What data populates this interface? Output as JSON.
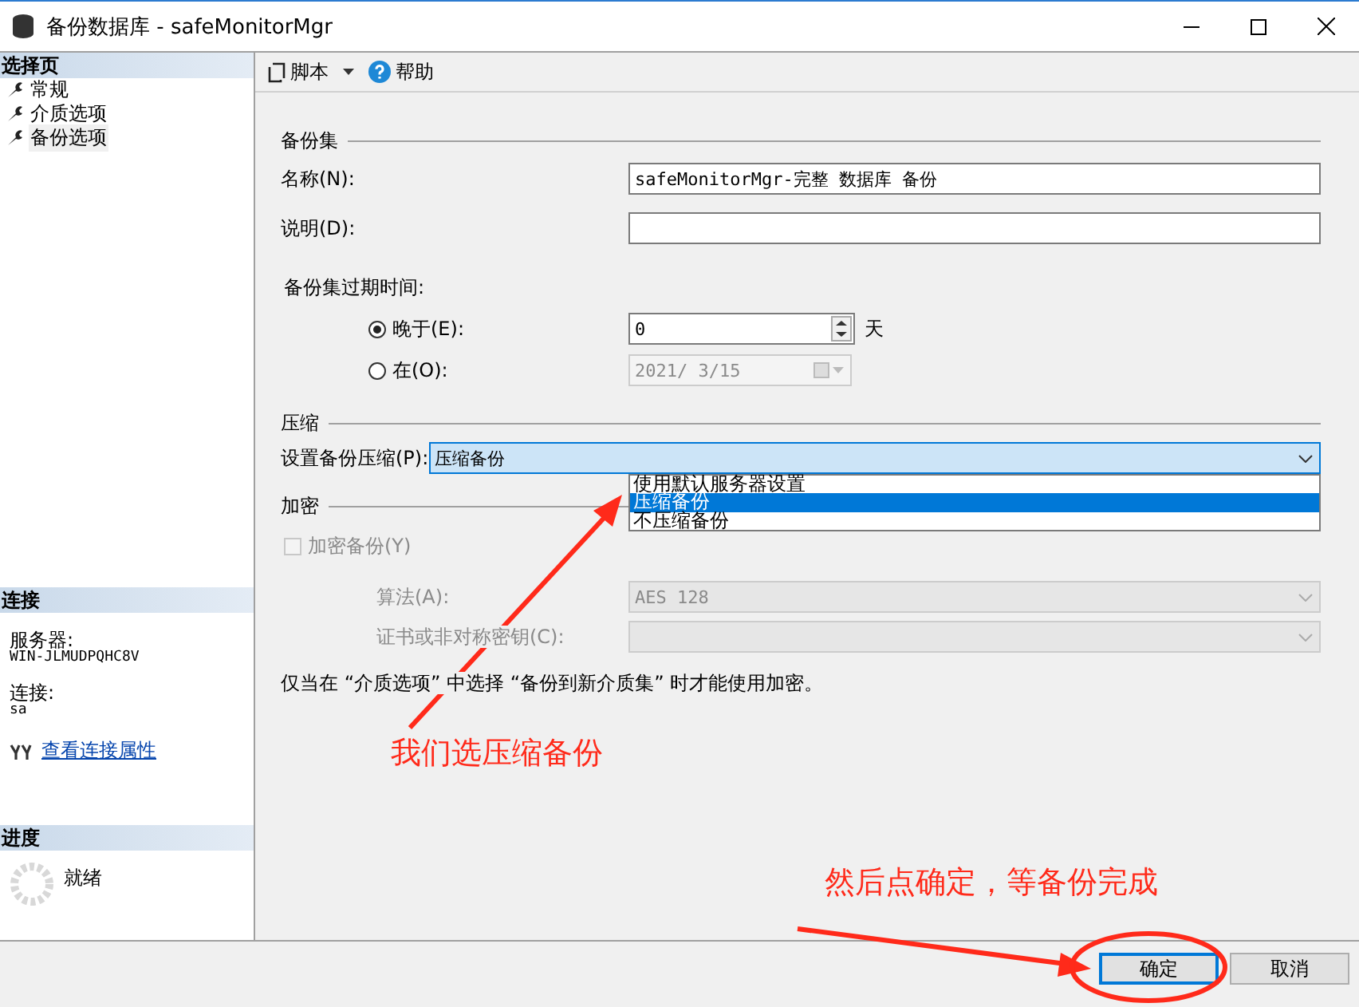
{
  "window": {
    "title": "备份数据库 - safeMonitorMgr"
  },
  "sidebar": {
    "pages_header": "选择页",
    "pages": [
      {
        "label": "常规",
        "selected": false
      },
      {
        "label": "介质选项",
        "selected": false
      },
      {
        "label": "备份选项",
        "selected": true
      }
    ],
    "connection": {
      "header": "连接",
      "server_label": "服务器:",
      "server": "WIN-JLMUDPQHC8V",
      "login_label": "连接:",
      "login": "sa",
      "link": "查看连接属性"
    },
    "progress": {
      "header": "进度",
      "status": "就绪"
    }
  },
  "toolbar": {
    "script": "脚本",
    "help": "帮助"
  },
  "backup_set": {
    "header": "备份集",
    "name_label": "名称(N):",
    "name_value": "safeMonitorMgr-完整 数据库 备份",
    "description_label": "说明(D):",
    "expiry_label": "备份集过期时间:",
    "options": [
      {
        "kind": "days",
        "label": "晚于(E):",
        "selected": true,
        "value": "0",
        "unit": "天"
      },
      {
        "kind": "date",
        "label": "在(O):",
        "selected": false,
        "value": "2021/ 3/15"
      }
    ]
  },
  "compression": {
    "header": "压缩",
    "label": "设置备份压缩(P):",
    "value": "压缩备份",
    "expanded": true,
    "options": [
      {
        "label": "使用默认服务器设置",
        "selected": false
      },
      {
        "label": "压缩备份",
        "selected": true
      },
      {
        "label": "不压缩备份",
        "selected": false
      }
    ]
  },
  "encryption": {
    "header": "加密",
    "checkbox_label": "加密备份(Y)",
    "checked": false,
    "disabled": true,
    "algorithm_label": "算法(A):",
    "algorithm": "AES 128",
    "certificate_label": "证书或非对称密钥(C):",
    "note": "仅当在 “介质选项” 中选择 “备份到新介质集” 时才能使用加密。"
  },
  "buttons": [
    {
      "label": "确定",
      "kind": "default"
    },
    {
      "label": "取消",
      "kind": "normal"
    }
  ],
  "annotations": [
    {
      "kind": "arrow-up",
      "text": "我们选压缩备份"
    },
    {
      "kind": "arrow-right",
      "text": "然后点确定，等备份完成"
    }
  ]
}
